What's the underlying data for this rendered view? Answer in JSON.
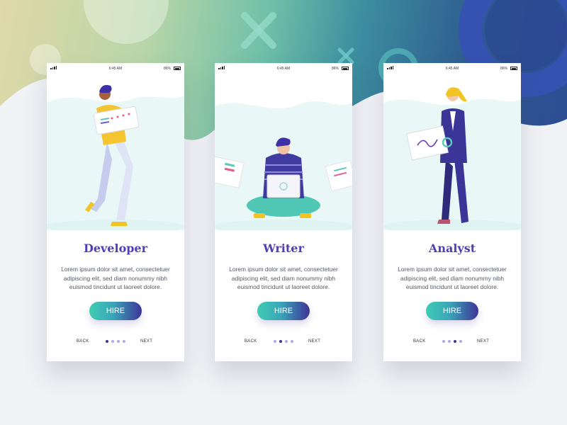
{
  "theme": {
    "accent": "#4e3fb2",
    "button_gradient_start": "#3ecdb3",
    "button_gradient_end": "#3e3497",
    "dot_active": "#3e348f",
    "dot_inactive": "#b3a9e6"
  },
  "status_bar": {
    "time": "6:45 AM",
    "battery": "86%"
  },
  "screens": [
    {
      "title": "Developer",
      "description": "Lorem ipsum dolor sit amet, consectetuer adipiscing elit, sed diam nonummy nibh euismod tincidunt ut laoreet dolore.",
      "button_label": "HIRE",
      "back_label": "BACK",
      "next_label": "NEXT",
      "active_page": 1,
      "page_count": 4,
      "illustration": "developer-illustration"
    },
    {
      "title": "Writer",
      "description": "Lorem ipsum dolor sit amet, consectetuer adipiscing elit, sed diam nonummy nibh euismod tincidunt ut laoreet dolore.",
      "button_label": "HIRE",
      "back_label": "BACK",
      "next_label": "NEXT",
      "active_page": 2,
      "page_count": 4,
      "illustration": "writer-illustration"
    },
    {
      "title": "Analyst",
      "description": "Lorem ipsum dolor sit amet, consectetuer adipiscing elit, sed diam nonummy nibh euismod tincidunt ut laoreet dolore.",
      "button_label": "HIRE",
      "back_label": "BACK",
      "next_label": "NEXT",
      "active_page": 3,
      "page_count": 4,
      "illustration": "analyst-illustration"
    }
  ]
}
